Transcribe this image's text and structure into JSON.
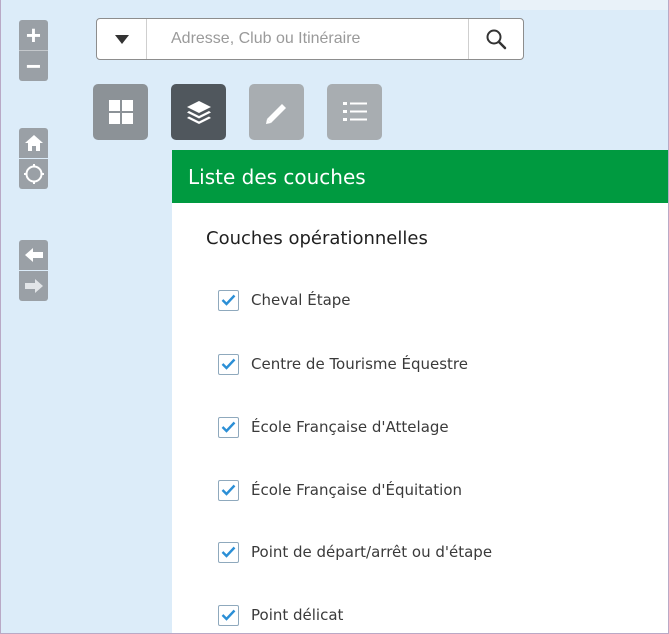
{
  "colors": {
    "accent": "#009a40",
    "map_background": "#dcecf9",
    "toolbar_button": "#9aa0a6",
    "active_widget": "#50575d",
    "checkbox_check": "#2b8fd6"
  },
  "map_toolbar": {
    "zoom_in": {
      "icon": "plus-icon",
      "glyph": "+"
    },
    "zoom_out": {
      "icon": "minus-icon",
      "glyph": "−"
    },
    "home": {
      "icon": "home-icon"
    },
    "locate": {
      "icon": "locate-icon"
    },
    "previous_extent": {
      "icon": "arrow-left-icon"
    },
    "next_extent": {
      "icon": "arrow-right-icon"
    }
  },
  "search": {
    "placeholder": "Adresse, Club ou Itinéraire",
    "value": "",
    "dropdown_icon": "caret-down-icon",
    "button_icon": "search-icon"
  },
  "widgets": [
    {
      "id": "basemap",
      "icon": "grid-icon",
      "active": false
    },
    {
      "id": "layers",
      "icon": "layers-icon",
      "active": true
    },
    {
      "id": "measure",
      "icon": "ruler-icon",
      "active": false
    },
    {
      "id": "legend",
      "icon": "list-icon",
      "active": false
    }
  ],
  "layer_panel": {
    "title": "Liste des couches",
    "subtitle": "Couches opérationnelles",
    "layers": [
      {
        "label": "Cheval Étape",
        "checked": true
      },
      {
        "label": "Centre de Tourisme Équestre",
        "checked": true
      },
      {
        "label": "École Française d'Attelage",
        "checked": true
      },
      {
        "label": "École Française d'Équitation",
        "checked": true
      },
      {
        "label": "Point de départ/arrêt ou d'étape",
        "checked": true
      },
      {
        "label": "Point délicat",
        "checked": true
      }
    ]
  }
}
